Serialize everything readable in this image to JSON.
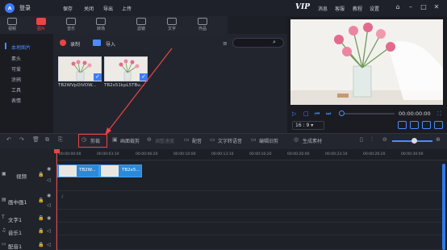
{
  "titlebar": {
    "login": "登录",
    "menu": [
      "保存",
      "关闭",
      "导出",
      "上传"
    ],
    "vip": "VIP",
    "right_menu": [
      "消息",
      "客服",
      "教程",
      "设置"
    ],
    "window_buttons": [
      "home-icon",
      "minimize-icon",
      "maximize-icon",
      "close-icon"
    ]
  },
  "toolbar": {
    "tools": [
      {
        "label": "视频",
        "icon": "video-icon"
      },
      {
        "label": "图片",
        "icon": "image-icon",
        "active": true
      },
      {
        "label": "音乐",
        "icon": "music-icon"
      },
      {
        "label": "转场",
        "icon": "transition-icon"
      },
      {
        "label": "滤镜",
        "icon": "filter-icon"
      },
      {
        "label": "文字",
        "icon": "text-icon"
      },
      {
        "label": "作品",
        "icon": "works-icon"
      }
    ]
  },
  "categories": {
    "items": [
      "本地图片",
      "素头",
      "可爱",
      "涂鸦",
      "工具",
      "表情"
    ],
    "selected_index": 0
  },
  "media": {
    "record_label": "录制",
    "import_label": "导入",
    "search_placeholder": "",
    "items": [
      {
        "name": "TB2WVpDiVOW..."
      },
      {
        "name": "TB2x51kpL5TBu..."
      }
    ]
  },
  "preview": {
    "time": "00:00:00:00",
    "ratio": "16 : 9",
    "controls": [
      "play-icon",
      "stop-icon",
      "prev-frame-icon",
      "next-frame-icon",
      "fullscreen-icon"
    ]
  },
  "edit_toolbar": {
    "items": [
      "剪裁",
      "画面裁剪",
      "调整速度",
      "配音",
      "文字转语音",
      "编辑旧剪",
      "生成素材"
    ],
    "split_label": "剪裁"
  },
  "ruler": {
    "ticks": [
      "00:00:00:00",
      "00:00:03:10",
      "00:00:06:20",
      "00:00:10:00",
      "00:00:13:10",
      "00:00:16:20",
      "00:00:20:00",
      "00:00:23:10",
      "00:00:26:20",
      "00:00:30:00"
    ]
  },
  "tracks": [
    {
      "label": "视频"
    },
    {
      "label": "画中画1"
    },
    {
      "label": "文字1"
    },
    {
      "label": "音乐1"
    },
    {
      "label": "配音1"
    }
  ],
  "clips": [
    {
      "name": "TB2W..."
    },
    {
      "name": "TB2x5..."
    }
  ],
  "colors": {
    "accent": "#3d7cff",
    "highlight_red": "#e84545",
    "clip_blue": "#2a89d9",
    "background": "#1c1f26"
  }
}
